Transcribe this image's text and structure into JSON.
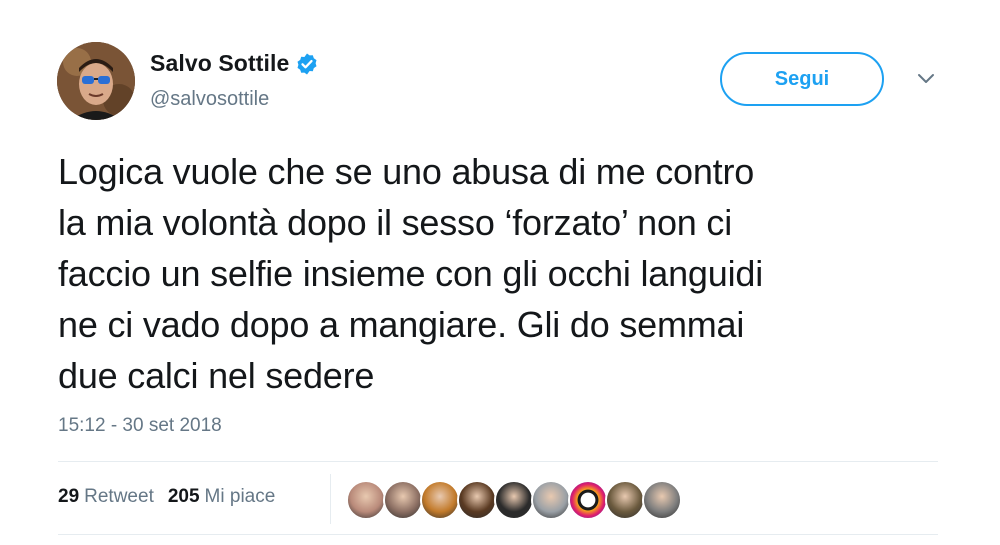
{
  "user": {
    "display_name": "Salvo Sottile",
    "handle": "@salvosottile",
    "verified": true
  },
  "follow_button": {
    "label": "Segui"
  },
  "tweet": {
    "lines": [
      "Logica vuole che se uno abusa di me contro",
      "la mia volontà  dopo il sesso ‘forzato’ non ci",
      "faccio un selfie insieme con gli occhi languidi",
      "ne ci vado dopo a mangiare. Gli do semmai",
      "due calci nel sedere"
    ],
    "timestamp": "15:12 - 30 set 2018"
  },
  "stats": {
    "retweets_count": "29",
    "retweets_label": "Retweet",
    "likes_count": "205",
    "likes_label": "Mi piace"
  },
  "likers": [
    {
      "color": "#b98a7a"
    },
    {
      "color": "#8c6f63"
    },
    {
      "color": "#c27a2a"
    },
    {
      "color": "#5a3a22"
    },
    {
      "color": "#2b2b2b"
    },
    {
      "color": "#9aa0a6"
    },
    {
      "color": "#e0206a"
    },
    {
      "color": "#6b5a3e"
    },
    {
      "color": "#7d7d7d"
    }
  ],
  "colors": {
    "accent": "#1da1f2",
    "text": "#14171a",
    "secondary": "#657786",
    "border": "#e6ecf0"
  }
}
